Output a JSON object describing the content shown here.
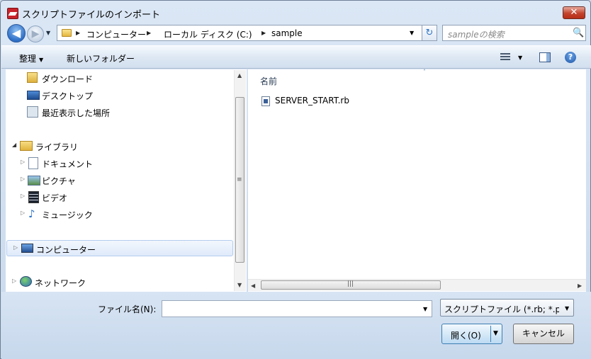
{
  "window": {
    "title": "スクリプトファイルのインポート",
    "close_glyph": "✕"
  },
  "nav": {
    "back_glyph": "◀",
    "forward_glyph": "▶",
    "dropdown_glyph": "▼"
  },
  "address": {
    "breadcrumbs": [
      "コンピューター",
      "ローカル ディスク (C:)",
      "sample"
    ],
    "separator_glyph": "▶",
    "dropdown_glyph": "▼"
  },
  "refresh_glyph": "↻",
  "search": {
    "placeholder": "sampleの検索",
    "icon_glyph": "🔍"
  },
  "toolbar": {
    "organize_label": "整理",
    "new_folder_label": "新しいフォルダー",
    "arrow_glyph": "▼",
    "help_glyph": "?"
  },
  "sidebar": {
    "items": [
      {
        "label": "ダウンロード",
        "icon": "download-folder-icon"
      },
      {
        "label": "デスクトップ",
        "icon": "desktop-icon"
      },
      {
        "label": "最近表示した場所",
        "icon": "recent-places-icon"
      },
      {
        "label": "ライブラリ",
        "icon": "libraries-icon",
        "expanded": true
      },
      {
        "label": "ドキュメント",
        "icon": "documents-icon"
      },
      {
        "label": "ピクチャ",
        "icon": "pictures-icon"
      },
      {
        "label": "ビデオ",
        "icon": "videos-icon"
      },
      {
        "label": "ミュージック",
        "icon": "music-icon"
      },
      {
        "label": "コンピューター",
        "icon": "computer-icon",
        "selected": true
      },
      {
        "label": "ネットワーク",
        "icon": "network-icon"
      }
    ],
    "expanded_glyph": "◢",
    "collapsed_glyph": "▷"
  },
  "file_list": {
    "column_name": "名前",
    "sort_glyph": "˄",
    "files": [
      {
        "name": "SERVER_START.rb",
        "icon": "ruby-file-icon"
      }
    ]
  },
  "scroll": {
    "up": "▲",
    "down": "▼",
    "left": "◀",
    "right": "▶",
    "grip_v": "≡",
    "grip_h": "|||"
  },
  "footer": {
    "filename_label": "ファイル名(N):",
    "filename_value": "",
    "filename_drop_glyph": "▼",
    "filetype_value": "スクリプトファイル (*.rb; *.p",
    "filetype_drop_glyph": "▼",
    "open_label": "開く(O)",
    "open_drop_glyph": "▼",
    "cancel_label": "キャンセル"
  }
}
